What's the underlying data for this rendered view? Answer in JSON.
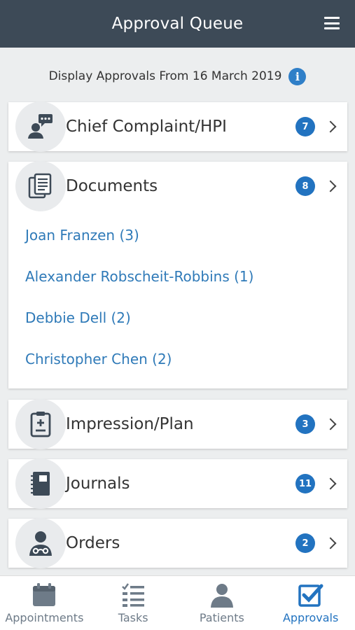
{
  "header": {
    "title": "Approval Queue",
    "menu_icon": "hamburger-menu-icon"
  },
  "filter": {
    "text": "Display Approvals From 16 March 2019",
    "info_icon": "info-icon",
    "info_glyph": "i"
  },
  "sections": [
    {
      "label": "Chief Complaint/HPI",
      "count": "7",
      "icon": "chat-person-icon"
    },
    {
      "label": "Documents",
      "count": "8",
      "icon": "documents-icon",
      "items": [
        "Joan Franzen (3)",
        "Alexander Robscheit-Robbins (1)",
        "Debbie Dell (2)",
        "Christopher Chen (2)"
      ]
    },
    {
      "label": "Impression/Plan",
      "count": "3",
      "icon": "clipboard-plus-icon"
    },
    {
      "label": "Journals",
      "count": "11",
      "icon": "journal-icon"
    },
    {
      "label": "Orders",
      "count": "2",
      "icon": "doctor-icon"
    }
  ],
  "tabbar": {
    "tabs": [
      {
        "label": "Appointments",
        "icon": "calendar-icon"
      },
      {
        "label": "Tasks",
        "icon": "checklist-icon"
      },
      {
        "label": "Patients",
        "icon": "person-icon"
      },
      {
        "label": "Approvals",
        "icon": "checkbox-icon",
        "active": true
      }
    ]
  },
  "colors": {
    "header": "#3d4a57",
    "accent": "#2273c0",
    "link": "#2f7ab8",
    "inactive": "#6e7b88"
  }
}
